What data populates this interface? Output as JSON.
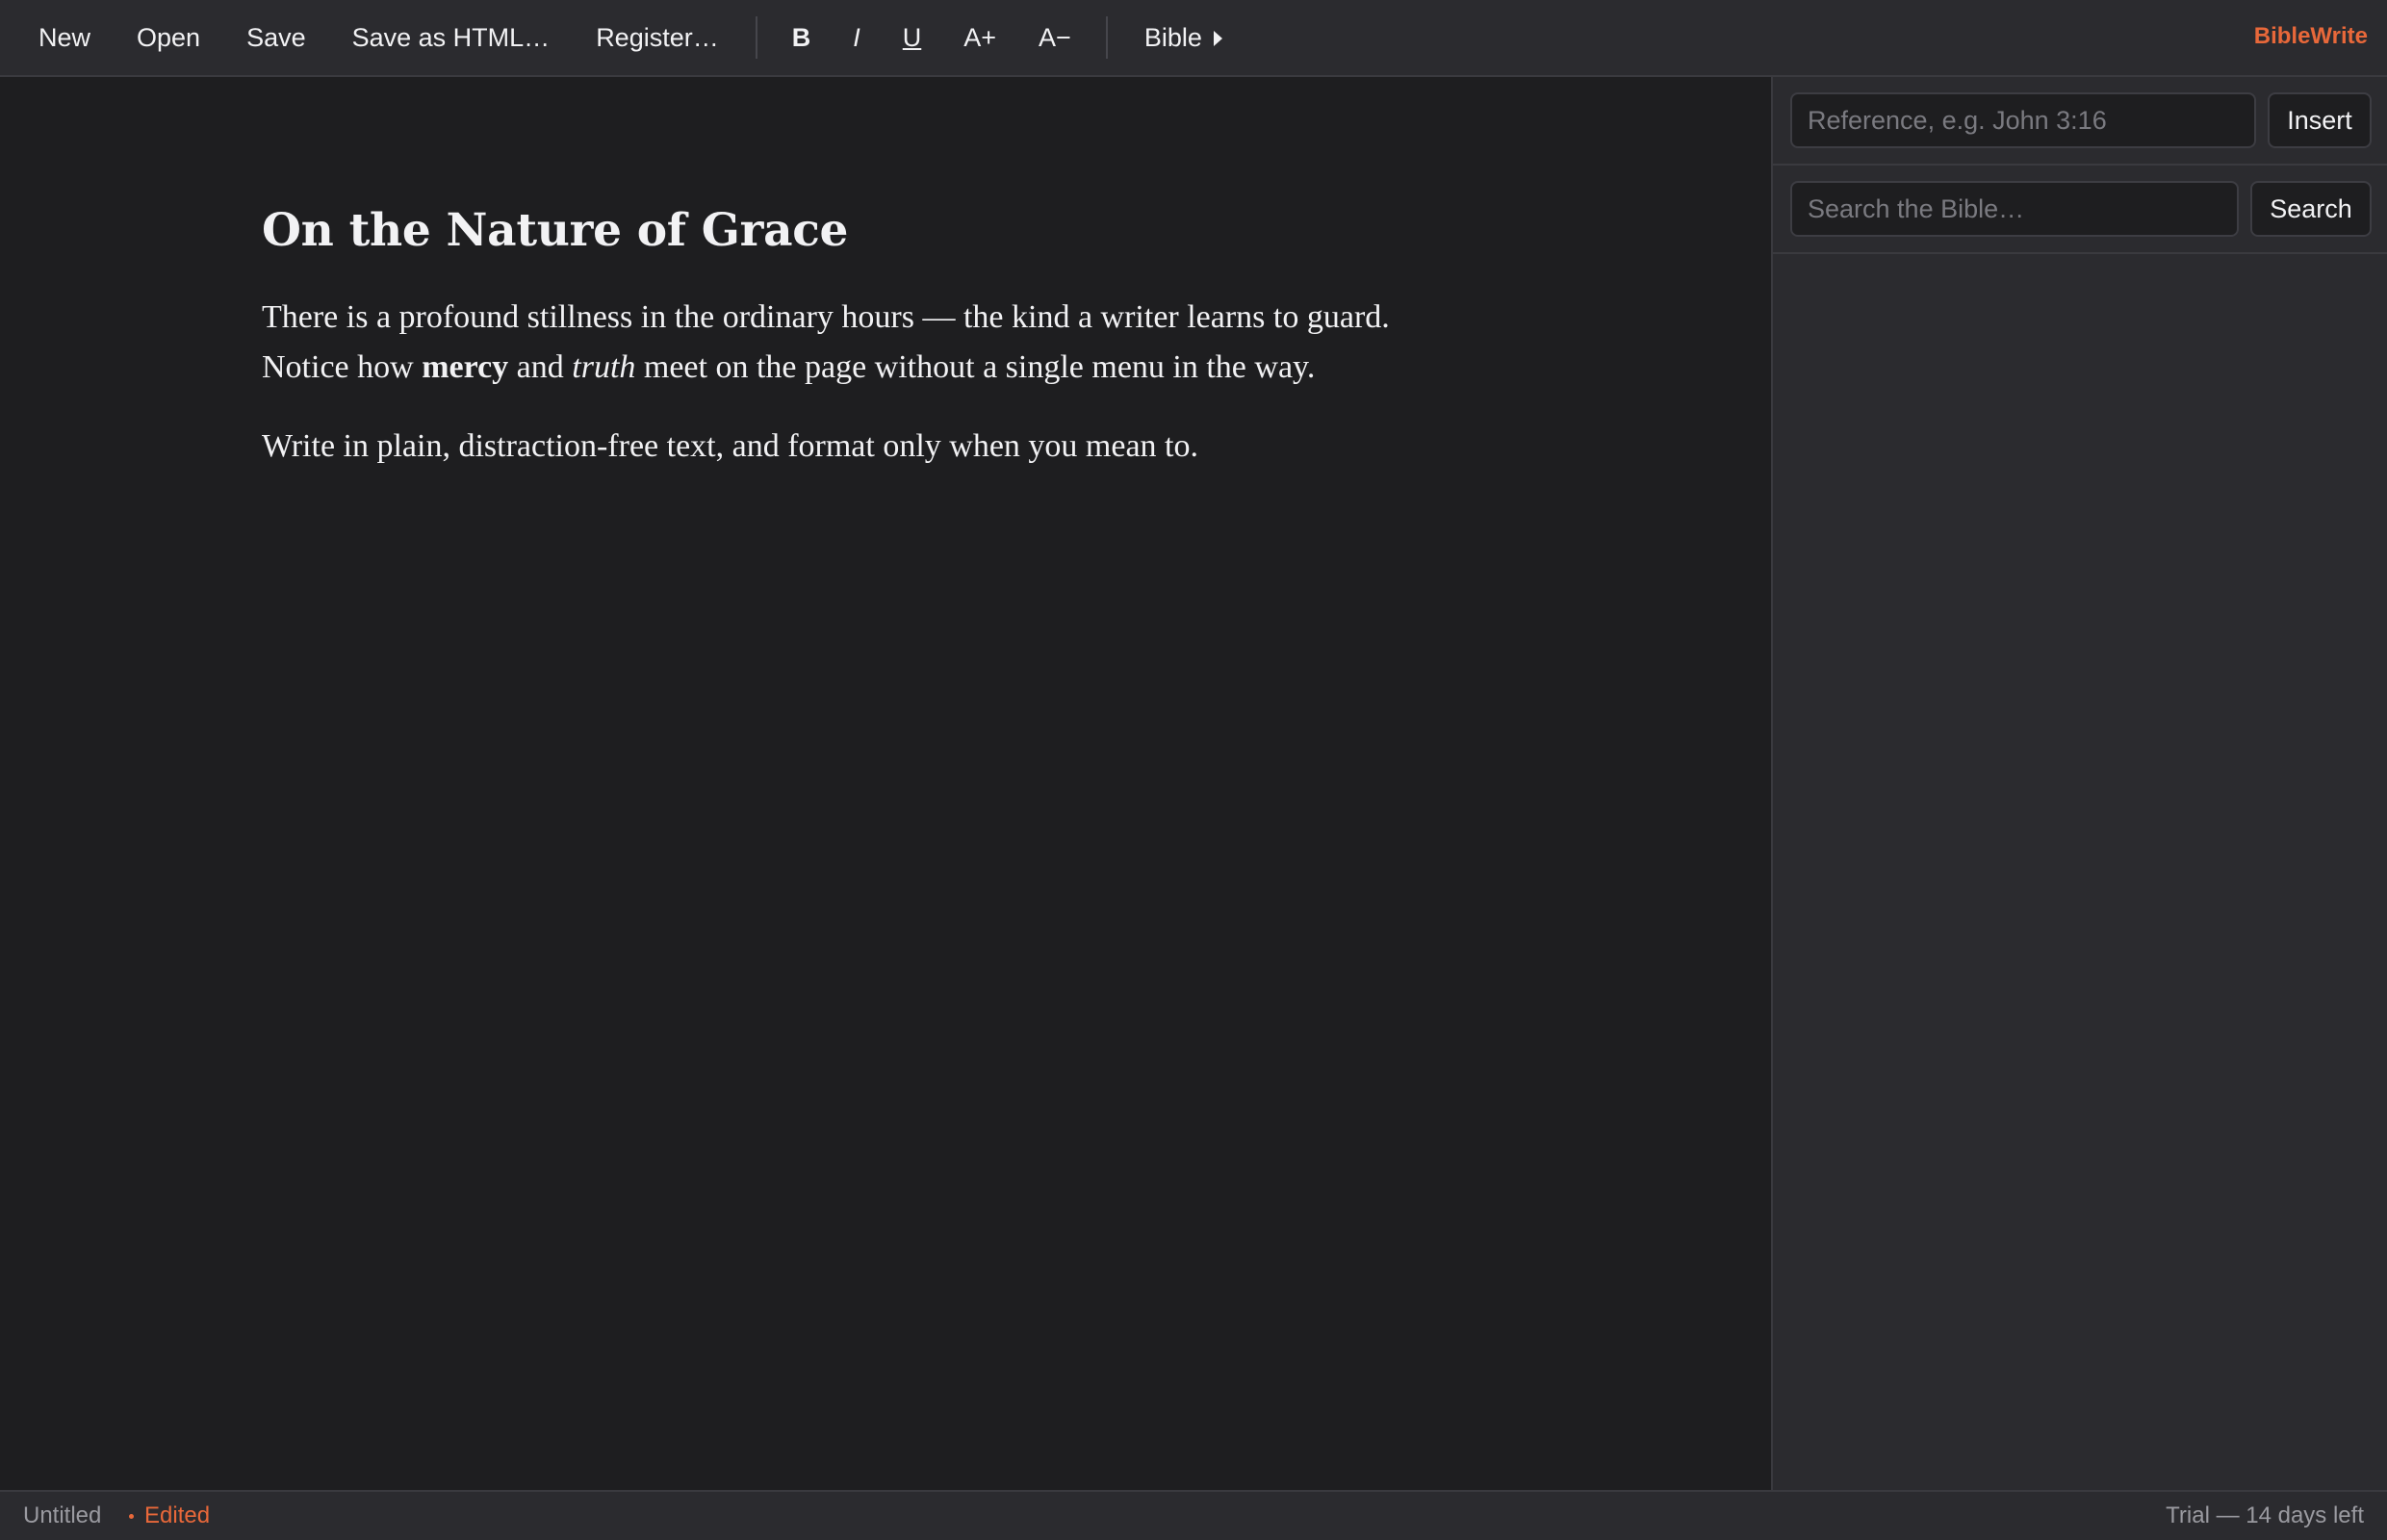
{
  "toolbar": {
    "file_buttons": {
      "new": "New",
      "open": "Open",
      "save": "Save",
      "save_html": "Save as HTML…",
      "register": "Register…"
    },
    "format_buttons": {
      "bold": "B",
      "italic": "I",
      "underline": "U",
      "font_bigger": "A+",
      "font_smaller": "A−"
    },
    "bible_menu": "Bible",
    "brand": "BibleWrite"
  },
  "document": {
    "title": "On the Nature of Grace",
    "paragraph1": {
      "line1": "There is a profound stillness in the ordinary hours — the kind a writer learns to guard.",
      "pre": "Notice how ",
      "bold": "mercy",
      "mid": " and ",
      "italic": "truth",
      "post": " meet on the page without a single menu in the way."
    },
    "paragraph2": "Write in plain, distraction-free text, and format only when you mean to."
  },
  "sidebar": {
    "reference": {
      "placeholder": "Reference, e.g. John 3:16",
      "value": "",
      "button": "Insert"
    },
    "search": {
      "placeholder": "Search the Bible…",
      "value": "",
      "button": "Search"
    }
  },
  "status": {
    "filename": "Untitled",
    "edited": "Edited",
    "trial": "Trial — 14 days left"
  },
  "colors": {
    "accent": "#e8683a",
    "background": "#1e1e20",
    "panel": "#2b2b2f"
  }
}
